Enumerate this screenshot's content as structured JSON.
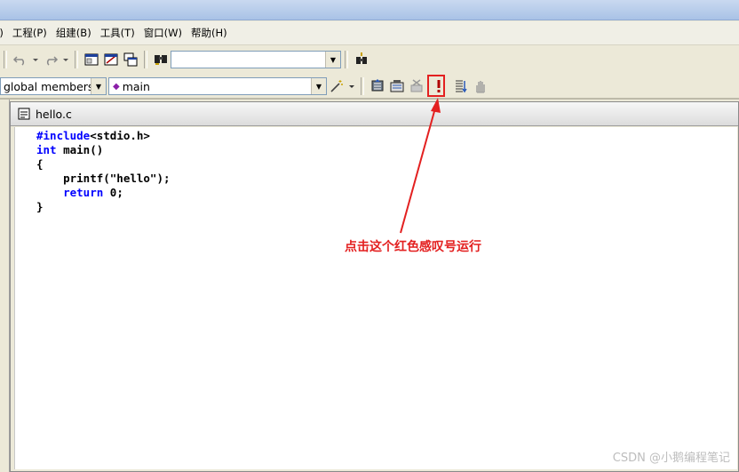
{
  "menubar": {
    "items": [
      "I)",
      "工程(P)",
      "组建(B)",
      "工具(T)",
      "窗口(W)",
      "帮助(H)"
    ]
  },
  "toolbar1": {
    "find_combo_value": ""
  },
  "toolbar2": {
    "scope_combo": "global members",
    "member_combo": "main"
  },
  "editor": {
    "tab_title": "hello.c",
    "code_lines": [
      [
        {
          "t": "#include",
          "c": "kw"
        },
        {
          "t": "<stdio.h>",
          "c": "pl"
        }
      ],
      [
        {
          "t": "int",
          "c": "kw"
        },
        {
          "t": " main()",
          "c": "pl"
        }
      ],
      [
        {
          "t": "{",
          "c": "pl"
        }
      ],
      [
        {
          "t": "    printf(\"hello\");",
          "c": "pl"
        }
      ],
      [
        {
          "t": "    ",
          "c": "pl"
        },
        {
          "t": "return",
          "c": "kw"
        },
        {
          "t": " 0;",
          "c": "pl"
        }
      ],
      [
        {
          "t": "}",
          "c": "pl"
        }
      ]
    ]
  },
  "annotation": {
    "text": "点击这个红色感叹号运行",
    "color": "#e32020"
  },
  "watermark": "CSDN @小鹅编程笔记"
}
